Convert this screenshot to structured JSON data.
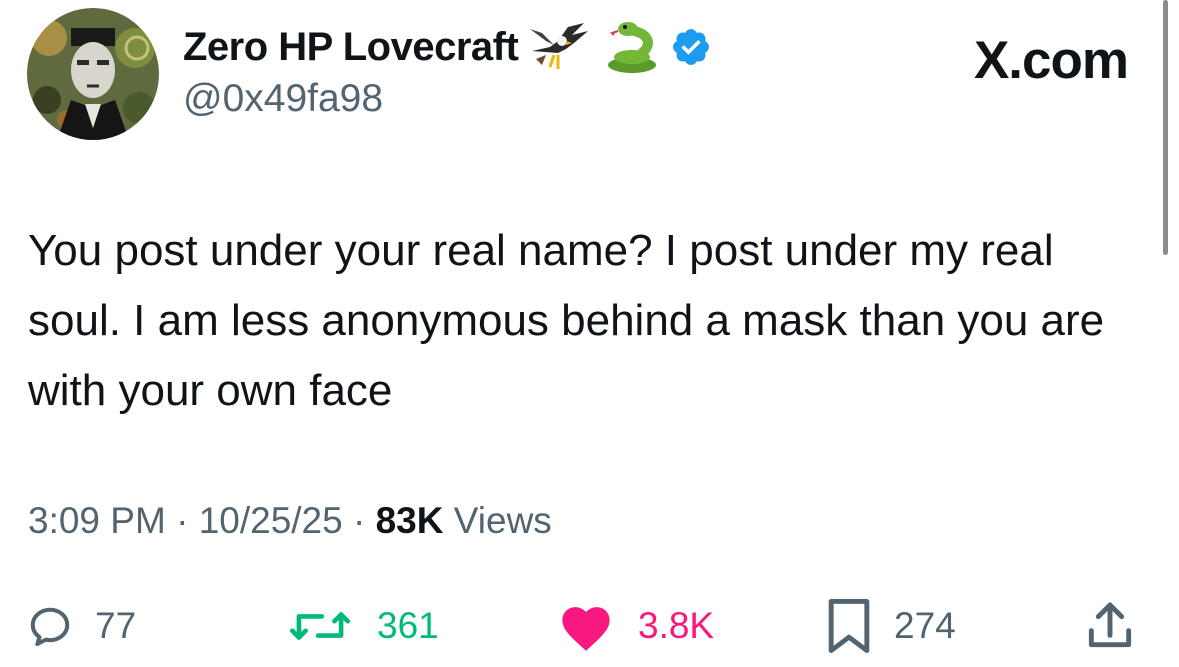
{
  "author": {
    "display_name": "Zero HP Lovecraft",
    "handle": "@0x49fa98",
    "badges": [
      "eagle-icon",
      "snake-icon",
      "verified-badge-icon"
    ]
  },
  "brand": "X.com",
  "tweet": {
    "text": "You post under your real name? I post under my real soul. I am less anonymous behind a mask than you are with your own face"
  },
  "meta": {
    "time": "3:09 PM",
    "date": "10/25/25",
    "views_count": "83K",
    "views_label": "Views",
    "separator": "·"
  },
  "actions": {
    "replies": "77",
    "retweets": "361",
    "likes": "3.8K",
    "bookmarks": "274"
  },
  "colors": {
    "text": "#0f1419",
    "secondary": "#536471",
    "verified": "#1d9bf0",
    "retweet": "#00ba7c",
    "like": "#f91880"
  }
}
